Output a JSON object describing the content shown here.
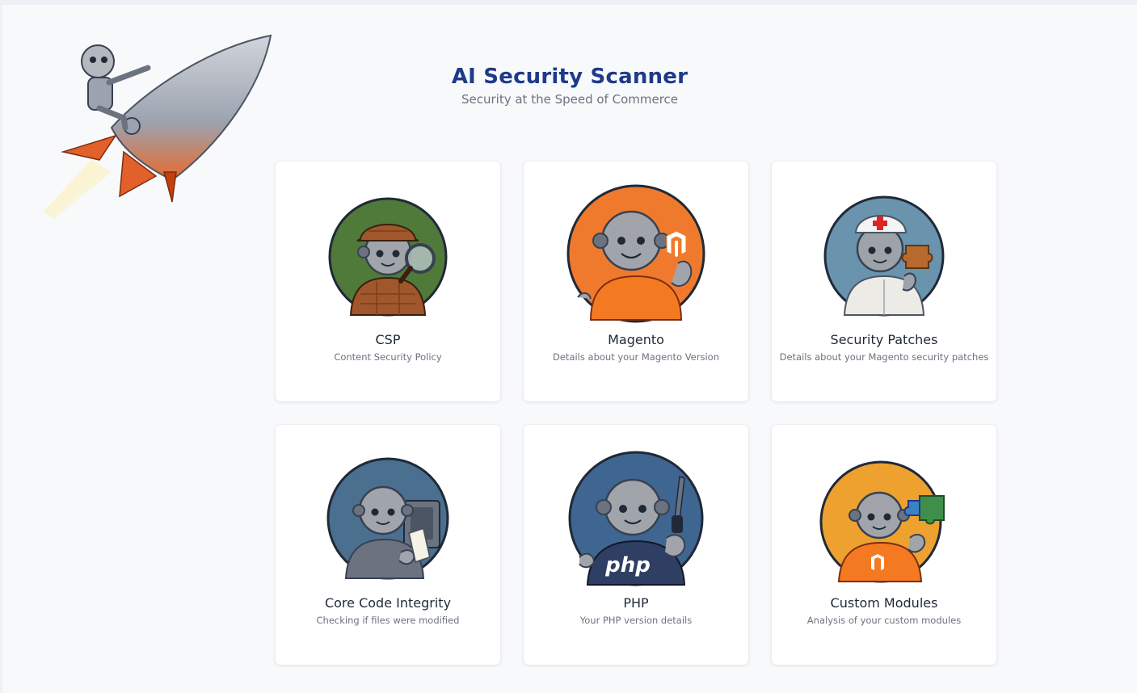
{
  "header": {
    "title": "AI Security Scanner",
    "subtitle": "Security at the Speed of Commerce"
  },
  "colors": {
    "title": "#1e3a8a",
    "page_bg": "#f8f9fb",
    "card_bg": "#ffffff"
  },
  "cards": [
    {
      "title": "CSP",
      "description": "Content Security Policy",
      "icon": "detective-robot-icon",
      "circle_color": "#4f7a3a"
    },
    {
      "title": "Magento",
      "description": "Details about your Magento Version",
      "icon": "magento-robot-icon",
      "circle_color": "#ef7a2e"
    },
    {
      "title": "Security Patches",
      "description": "Details about your Magento security patches",
      "icon": "nurse-robot-icon",
      "circle_color": "#6a93ad"
    },
    {
      "title": "Core Code Integrity",
      "description": "Checking if files were modified",
      "icon": "safe-robot-icon",
      "circle_color": "#4b6f8f"
    },
    {
      "title": "PHP",
      "description": "Your PHP version details",
      "icon": "php-robot-icon",
      "circle_color": "#3f6591",
      "shirt_text": "php"
    },
    {
      "title": "Custom Modules",
      "description": "Analysis of your custom modules",
      "icon": "puzzle-robot-icon",
      "circle_color": "#eea12f"
    }
  ]
}
